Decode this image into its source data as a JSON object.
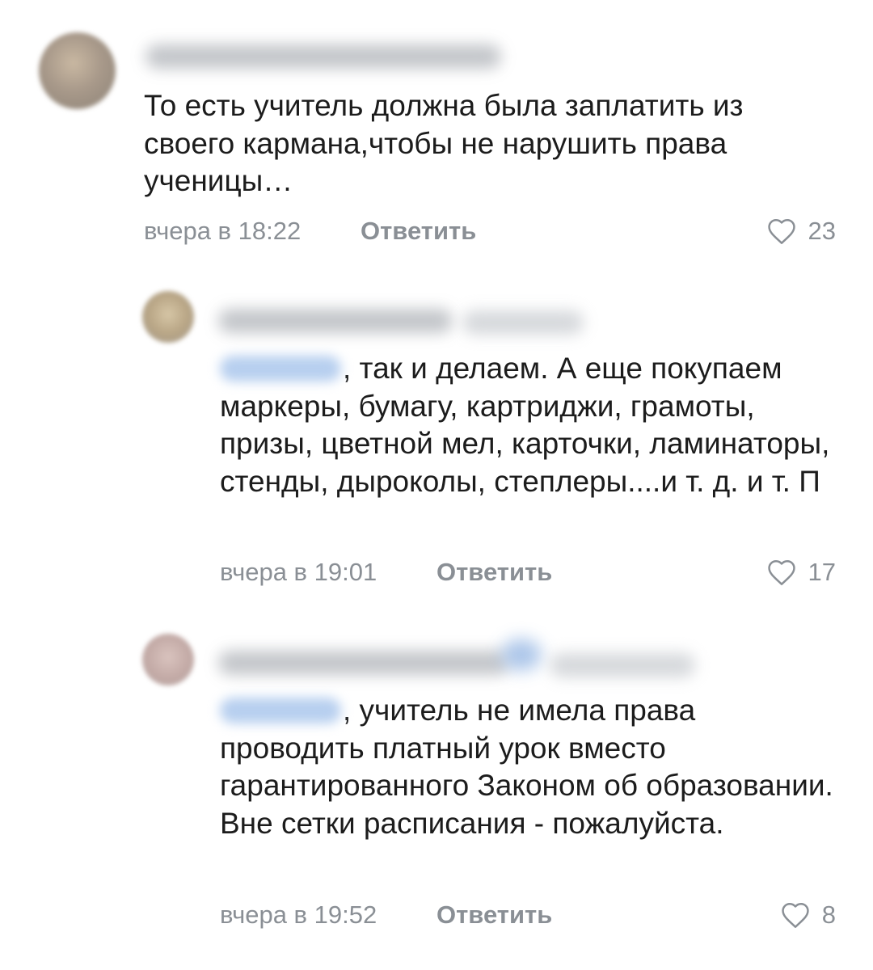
{
  "comments": [
    {
      "text": "То есть учитель должна была заплатить из своего кармана,чтобы не нарушить права ученицы…",
      "time": "вчера в 18:22",
      "reply_label": "Ответить",
      "likes": "23"
    },
    {
      "text": ", так и делаем. А еще покупаем маркеры, бумагу, картриджи, грамоты, призы, цветной мел, карточки, ламинаторы, стенды, дыроколы, степлеры....и т. д. и т. П",
      "time": "вчера в 19:01",
      "reply_label": "Ответить",
      "likes": "17"
    },
    {
      "text": ", учитель не имела права проводить платный урок вместо гарантированного Законом об образовании. Вне сетки расписания - пожалуйста.",
      "time": "вчера в 19:52",
      "reply_label": "Ответить",
      "likes": "8"
    }
  ],
  "colors": {
    "text": "#1c1c1c",
    "meta": "#8a8f95",
    "mention": "#b7cfef"
  },
  "icons": {
    "like": "heart-outline-icon"
  }
}
